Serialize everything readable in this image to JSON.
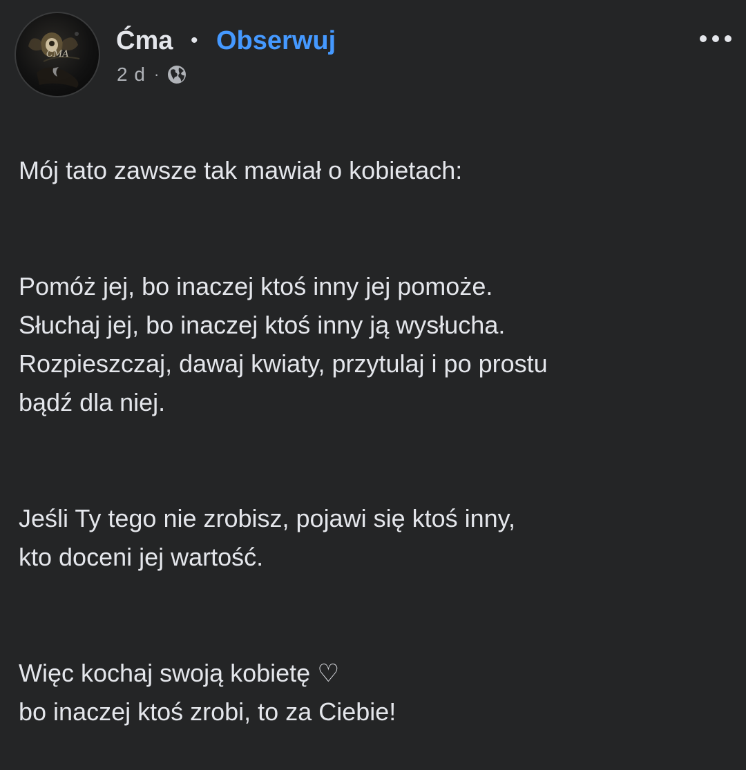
{
  "post": {
    "author": {
      "name": "Ćma",
      "avatar_text": "ĆMA",
      "avatar_icon": "moth-avatar"
    },
    "separator": "•",
    "follow_label": "Obserwuj",
    "timestamp": "2 d",
    "meta_separator": "·",
    "audience_icon": "globe-icon",
    "more_icon": "more-options-icon",
    "paragraphs": [
      "Mój tato zawsze tak mawiał o kobietach:",
      "Pomóż jej, bo inaczej ktoś inny jej pomoże.\nSłuchaj jej, bo inaczej ktoś inny ją wysłucha.\nRozpieszczaj, dawaj kwiaty, przytulaj i po prostu\nbądź dla niej.",
      "Jeśli Ty tego nie zrobisz, pojawi się ktoś inny,\nkto doceni jej wartość.",
      "Więc kochaj swoją kobietę ♡\nbo inaczej ktoś zrobi, to za Ciebie!"
    ]
  },
  "colors": {
    "background": "#242526",
    "text_primary": "#e4e6eb",
    "text_secondary": "#b0b3b8",
    "link": "#4599ff"
  }
}
